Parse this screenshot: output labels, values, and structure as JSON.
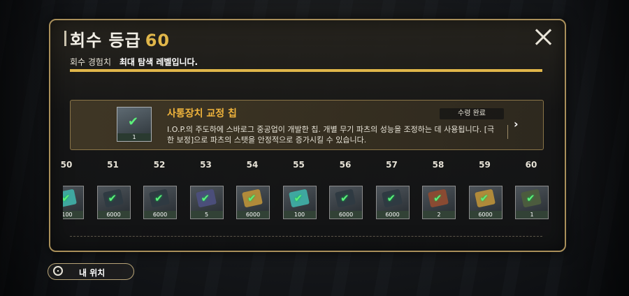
{
  "header": {
    "title": "회수 등급",
    "level": "60"
  },
  "exp": {
    "label": "회수 경험치",
    "status_text": "최대 탐색 레벨입니다.",
    "progress": 1.0
  },
  "reward_card": {
    "name": "사통장치 교정 칩",
    "description": "I.O.P.의 주도하에 스바로그 중공업이 개발한 칩. 개별 무기 파츠의 성능을 조정하는 데 사용됩니다. [극한 보정]으로 파츠의 스탯을 안정적으로 증가시킬 수 있습니다.",
    "status": "수령 완료",
    "quantity": "1",
    "icon": "chip-icon"
  },
  "track": {
    "levels": [
      "50",
      "51",
      "52",
      "53",
      "54",
      "55",
      "56",
      "57",
      "58",
      "59",
      "60"
    ],
    "items": [
      {
        "qty": "100",
        "color": "#3fa7a0",
        "icon": "crystal-icon"
      },
      {
        "qty": "6000",
        "color": "#2f3a42",
        "icon": "book-icon"
      },
      {
        "qty": "6000",
        "color": "#2f3a42",
        "icon": "book-icon"
      },
      {
        "qty": "5",
        "color": "#4b4e7a",
        "icon": "card-icon"
      },
      {
        "qty": "6000",
        "color": "#b08a3a",
        "icon": "book-icon"
      },
      {
        "qty": "100",
        "color": "#3fa7a0",
        "icon": "crystal-icon"
      },
      {
        "qty": "6000",
        "color": "#2f3a42",
        "icon": "book-icon"
      },
      {
        "qty": "6000",
        "color": "#2f3a42",
        "icon": "book-icon"
      },
      {
        "qty": "2",
        "color": "#8a4a32",
        "icon": "box-icon"
      },
      {
        "qty": "6000",
        "color": "#b08a3a",
        "icon": "book-icon"
      },
      {
        "qty": "1",
        "color": "#4c5b3e",
        "icon": "chip-icon"
      }
    ]
  },
  "location_button": {
    "label": "내 위치",
    "icon": "target-icon"
  }
}
